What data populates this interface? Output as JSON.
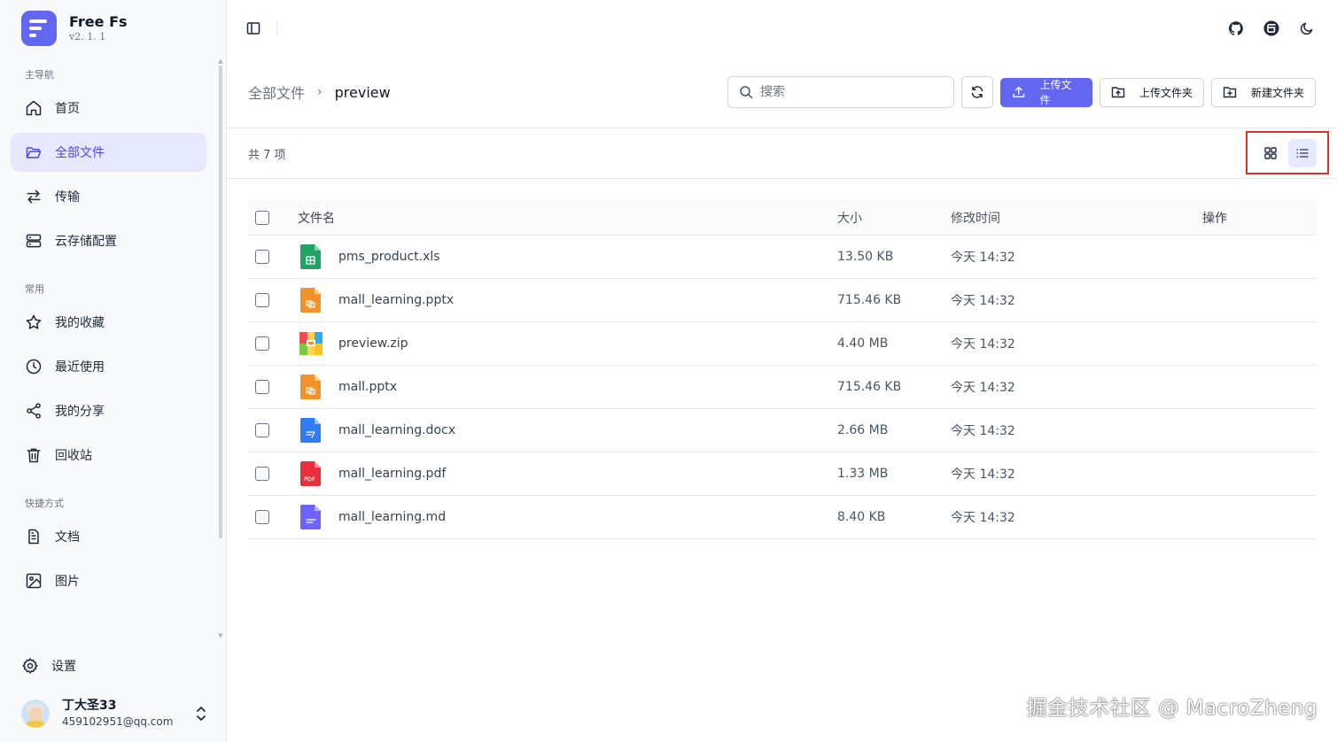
{
  "brand": {
    "name": "Free Fs",
    "version": "v2. 1. 1"
  },
  "sidebar": {
    "sections": [
      {
        "title": "主导航",
        "items": [
          {
            "label": "首页",
            "icon": "home-icon"
          },
          {
            "label": "全部文件",
            "icon": "folder-open-icon",
            "active": true
          },
          {
            "label": "传输",
            "icon": "transfer-icon"
          },
          {
            "label": "云存储配置",
            "icon": "server-icon"
          }
        ]
      },
      {
        "title": "常用",
        "items": [
          {
            "label": "我的收藏",
            "icon": "star-icon"
          },
          {
            "label": "最近使用",
            "icon": "clock-icon"
          },
          {
            "label": "我的分享",
            "icon": "share-icon"
          },
          {
            "label": "回收站",
            "icon": "trash-icon"
          }
        ]
      },
      {
        "title": "快捷方式",
        "items": [
          {
            "label": "文档",
            "icon": "document-icon"
          },
          {
            "label": "图片",
            "icon": "image-icon"
          }
        ]
      }
    ],
    "settings_label": "设置",
    "user": {
      "name": "丁大圣33",
      "email": "459102951@qq.com"
    }
  },
  "toolbar": {
    "breadcrumb_root": "全部文件",
    "breadcrumb_current": "preview",
    "search_placeholder": "搜索",
    "upload_file": "上传文件",
    "upload_folder": "上传文件夹",
    "new_folder": "新建文件夹"
  },
  "count_text": "共 7 项",
  "table": {
    "headers": {
      "name": "文件名",
      "size": "大小",
      "time": "修改时间",
      "op": "操作"
    },
    "rows": [
      {
        "name": "pms_product.xls",
        "size": "13.50 KB",
        "time": "今天 14:32",
        "type": "xls"
      },
      {
        "name": "mall_learning.pptx",
        "size": "715.46 KB",
        "time": "今天 14:32",
        "type": "ppt"
      },
      {
        "name": "preview.zip",
        "size": "4.40 MB",
        "time": "今天 14:32",
        "type": "zip"
      },
      {
        "name": "mall.pptx",
        "size": "715.46 KB",
        "time": "今天 14:32",
        "type": "ppt"
      },
      {
        "name": "mall_learning.docx",
        "size": "2.66 MB",
        "time": "今天 14:32",
        "type": "doc"
      },
      {
        "name": "mall_learning.pdf",
        "size": "1.33 MB",
        "time": "今天 14:32",
        "type": "pdf"
      },
      {
        "name": "mall_learning.md",
        "size": "8.40 KB",
        "time": "今天 14:32",
        "type": "md"
      }
    ]
  },
  "watermark": "掘金技术社区 @ MacroZheng",
  "colors": {
    "accent": "#6366f1",
    "active_bg": "#e6e8fd",
    "highlight_box": "#e0302d"
  }
}
